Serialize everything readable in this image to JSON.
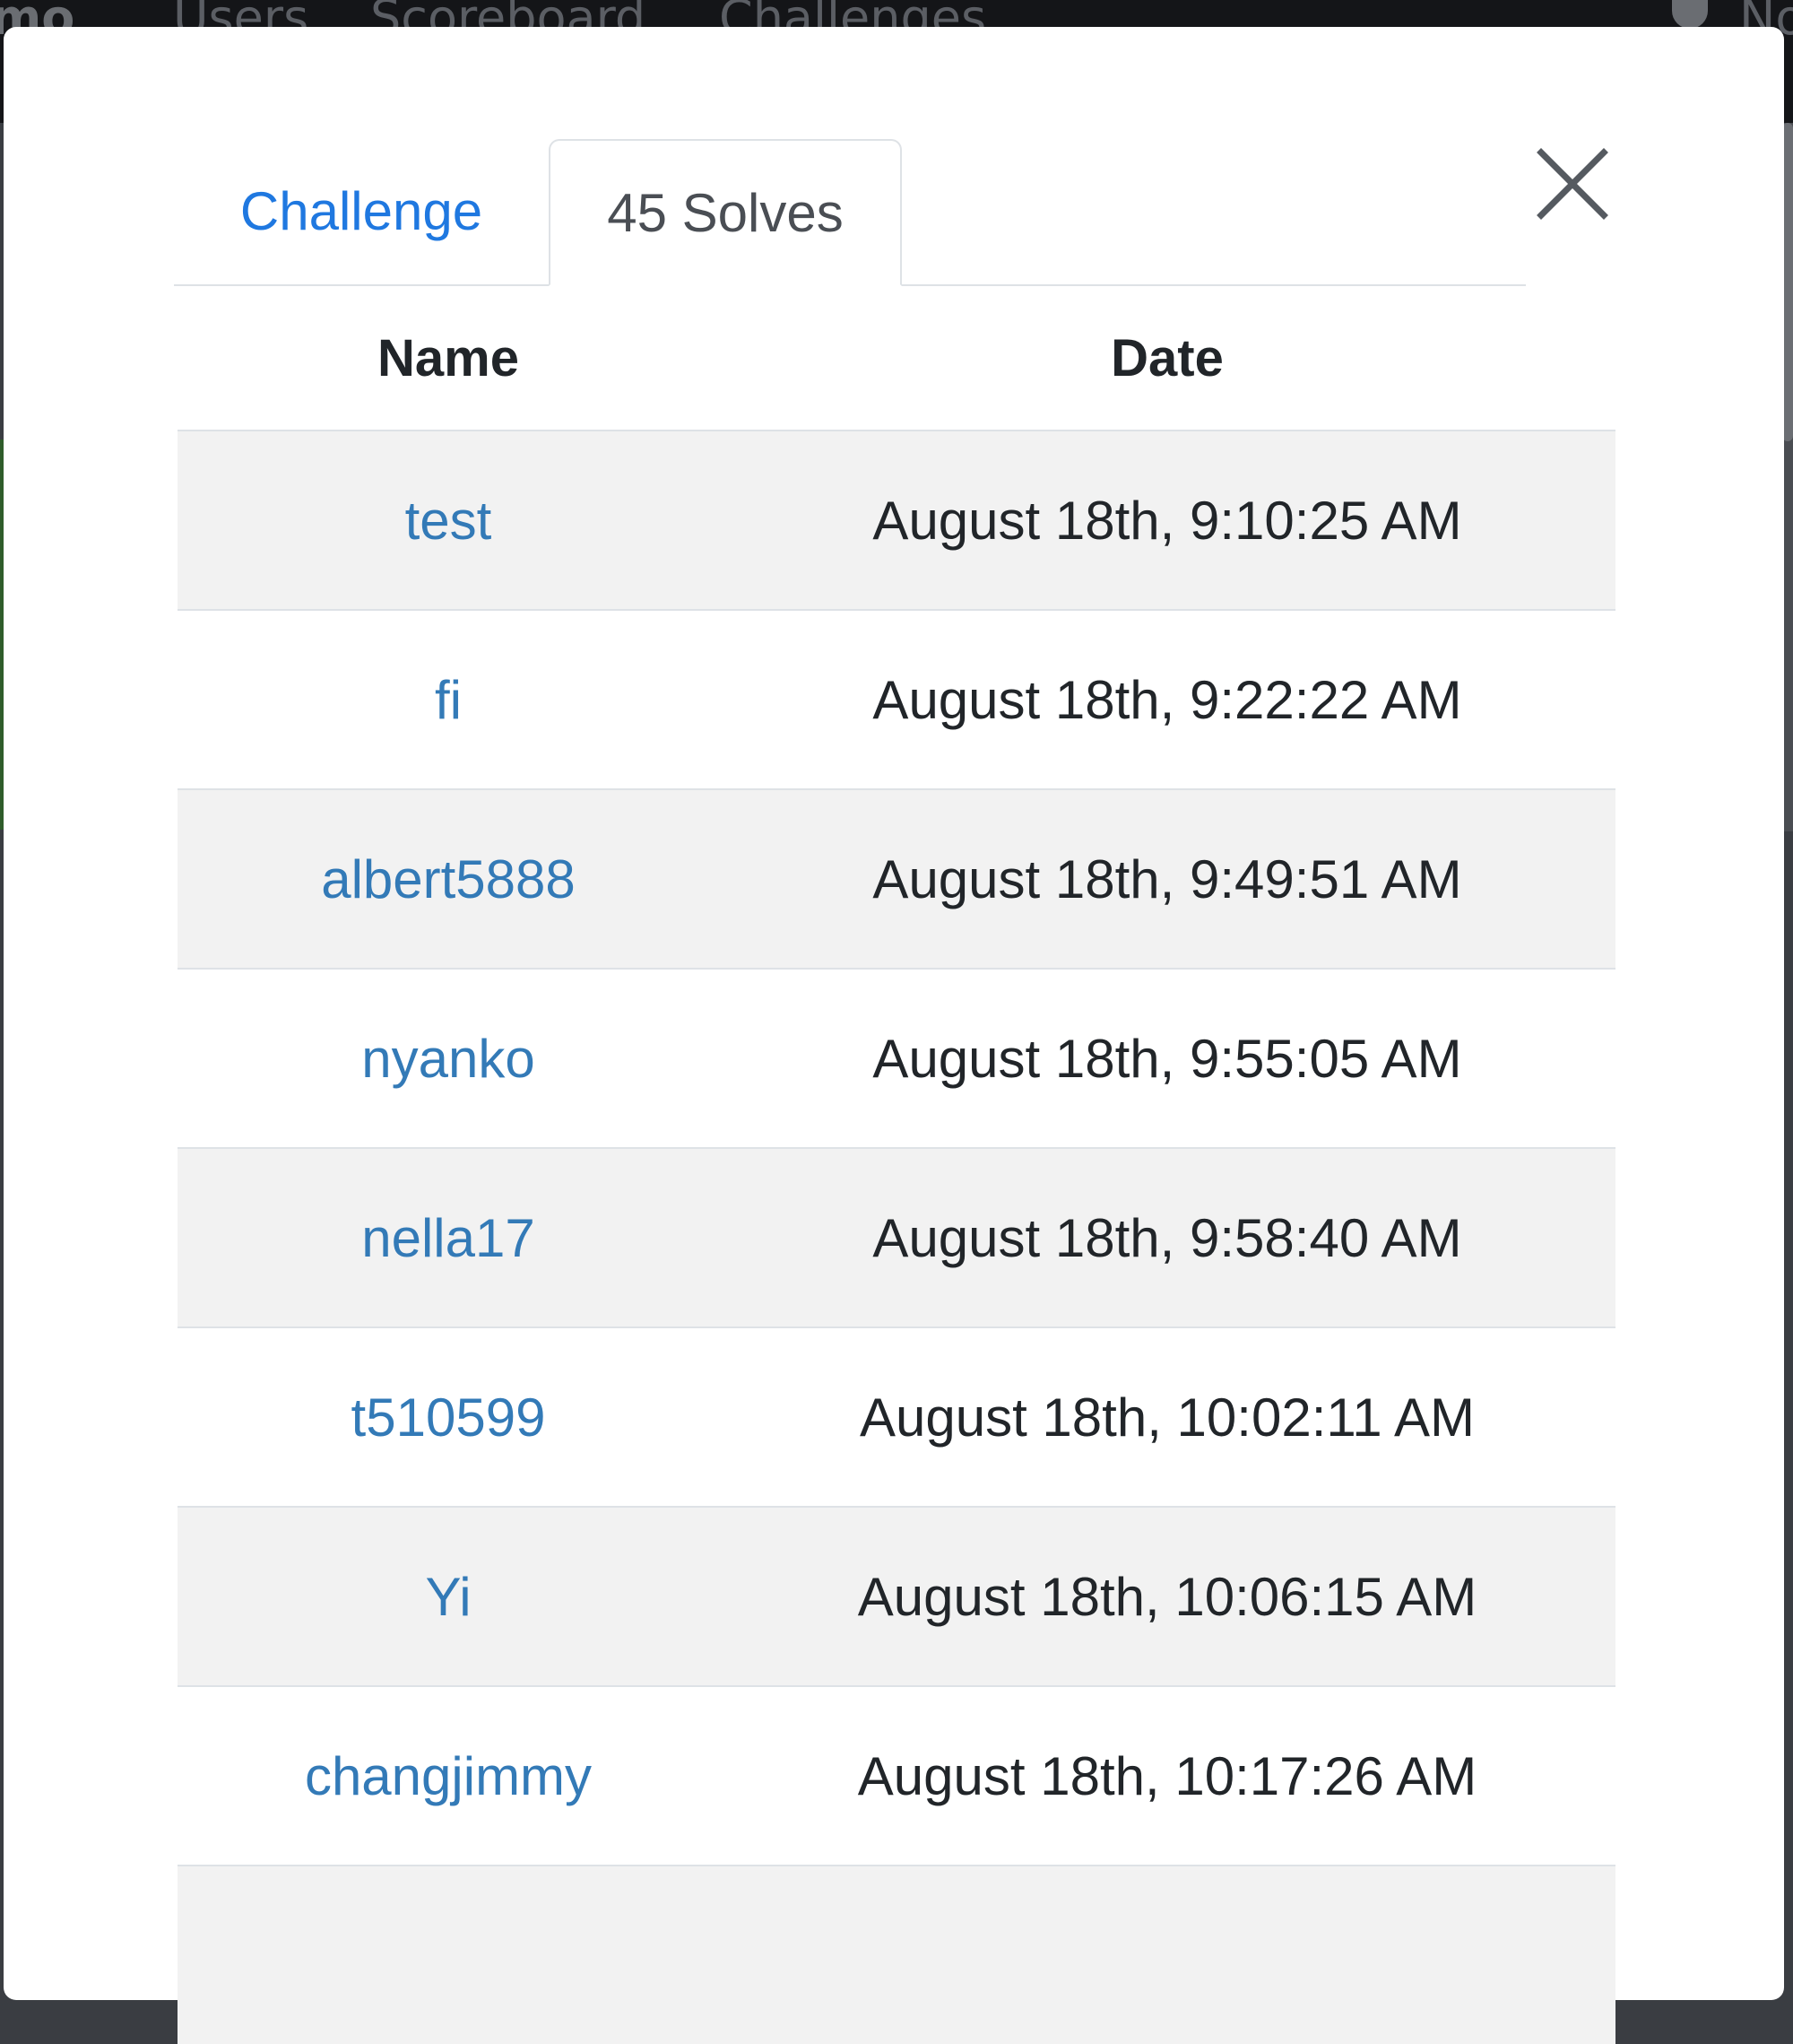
{
  "background": {
    "nav": {
      "brand": "mo",
      "links": [
        "Users",
        "Scoreboard",
        "Challenges"
      ],
      "right_text": "No"
    }
  },
  "modal": {
    "tabs": [
      {
        "label": "Challenge",
        "active": false
      },
      {
        "label": "45 Solves",
        "active": true
      }
    ],
    "close_icon": "close-icon",
    "table": {
      "headers": [
        "Name",
        "Date"
      ],
      "rows": [
        {
          "name": "test",
          "date": "August 18th, 9:10:25 AM"
        },
        {
          "name": "ﬁ",
          "date": "August 18th, 9:22:22 AM"
        },
        {
          "name": "albert5888",
          "date": "August 18th, 9:49:51 AM"
        },
        {
          "name": "nyanko",
          "date": "August 18th, 9:55:05 AM"
        },
        {
          "name": "nella17",
          "date": "August 18th, 9:58:40 AM"
        },
        {
          "name": "t510599",
          "date": "August 18th, 10:02:11 AM"
        },
        {
          "name": "Yi",
          "date": "August 18th, 10:06:15 AM"
        },
        {
          "name": "changjimmy",
          "date": "August 18th, 10:17:26 AM"
        }
      ]
    }
  },
  "colors": {
    "link": "#337ab7",
    "tab_active_link": "#1f78e0",
    "row_stripe": "#f2f2f2",
    "border": "#dee2e6"
  }
}
